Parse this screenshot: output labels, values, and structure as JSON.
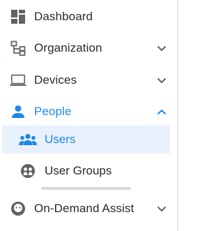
{
  "nav": {
    "dashboard": {
      "label": "Dashboard",
      "icon": "dashboard-icon"
    },
    "organization": {
      "label": "Organization",
      "icon": "organization-icon",
      "expanded": false
    },
    "devices": {
      "label": "Devices",
      "icon": "laptop-icon",
      "expanded": false
    },
    "people": {
      "label": "People",
      "icon": "person-icon",
      "expanded": true,
      "children": [
        {
          "label": "Users",
          "icon": "users-icon",
          "selected": true
        },
        {
          "label": "User Groups",
          "icon": "user-groups-icon",
          "selected": false
        }
      ]
    },
    "on_demand_assist": {
      "label": "On-Demand Assist",
      "icon": "assist-agent-icon",
      "expanded": false
    }
  },
  "colors": {
    "accent": "#1e88e5",
    "text": "#262a30",
    "icon": "#5f6368",
    "selected_bg": "#e8f1fb"
  }
}
